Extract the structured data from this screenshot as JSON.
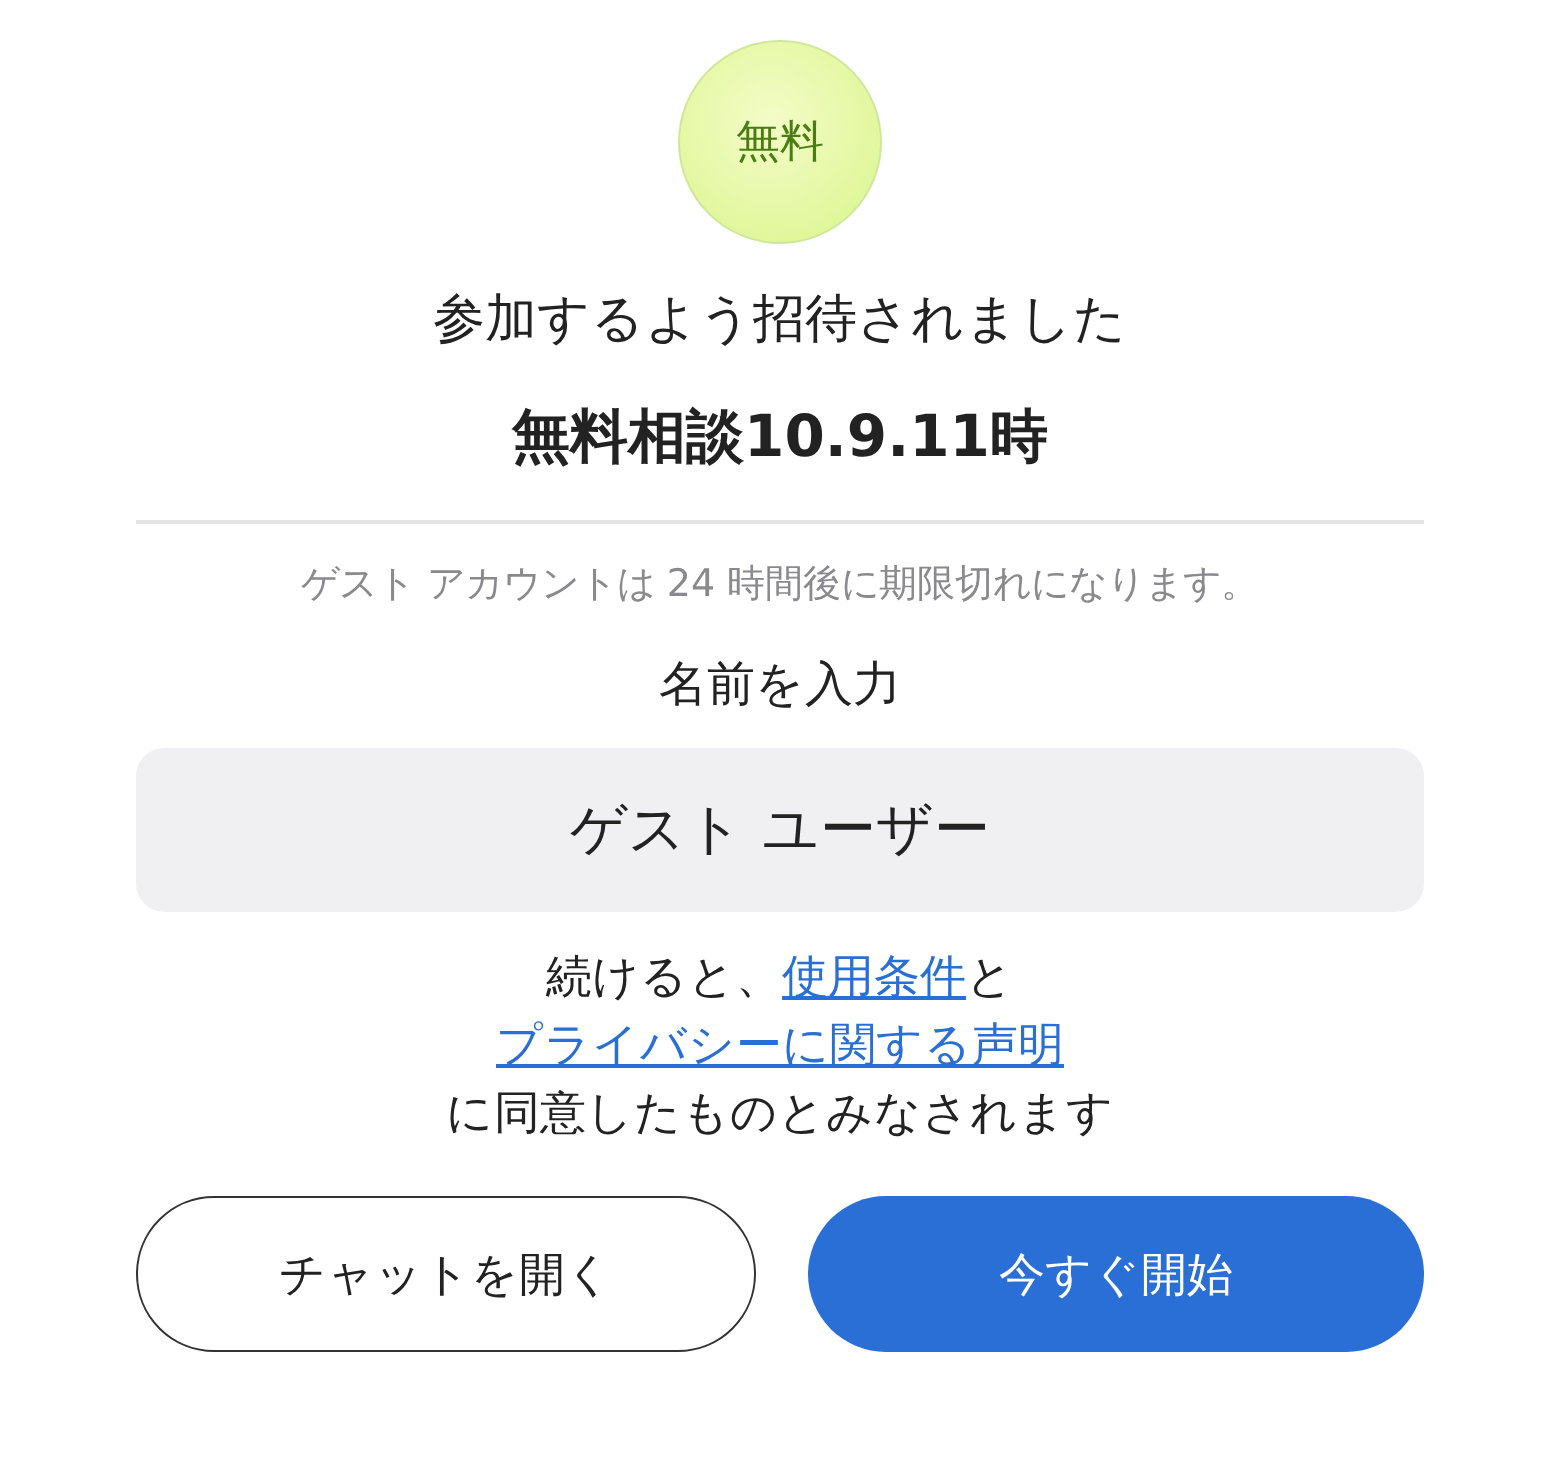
{
  "badge": {
    "label": "無料"
  },
  "invite_title": "参加するよう招待されました",
  "meeting_name": "無料相談10.9.11時",
  "guest_notice": "ゲスト アカウントは 24 時間後に期限切れになります。",
  "name_field": {
    "label": "名前を入力",
    "value": "ゲスト ユーザー"
  },
  "consent": [
    [
      {
        "kind": "text",
        "text": "続けると、"
      },
      {
        "kind": "link",
        "text": "使用条件"
      },
      {
        "kind": "text",
        "text": "と"
      }
    ],
    [
      {
        "kind": "link",
        "text": "プライバシーに関する声明"
      }
    ],
    [
      {
        "kind": "text",
        "text": "に同意したものとみなされます"
      }
    ]
  ],
  "buttons": [
    {
      "label": "チャットを開く",
      "kind": "secondary"
    },
    {
      "label": "今すぐ開始",
      "kind": "primary"
    }
  ]
}
